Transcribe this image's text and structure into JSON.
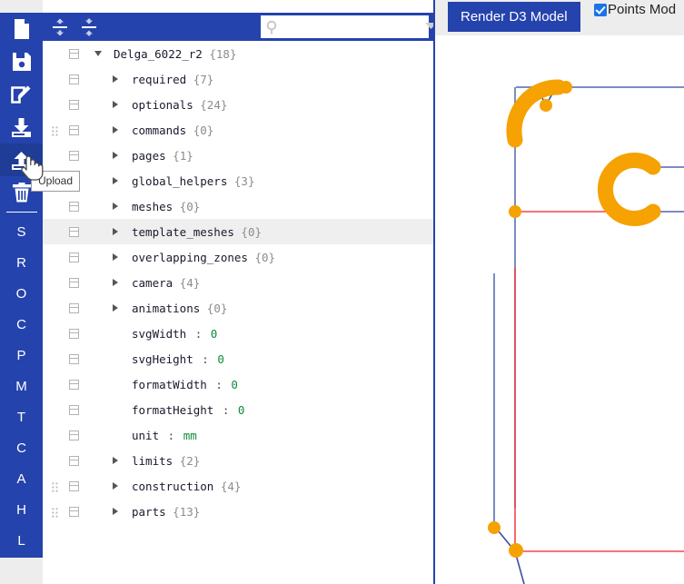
{
  "app": {
    "accent_blue": "#2543ad",
    "selection_blue": "#2a7fff",
    "point_orange": "#f5a202",
    "construction_red": "#f4454d",
    "line_blue": "#7a8cc4"
  },
  "icon_rail": {
    "icons": [
      {
        "name": "new-file-icon",
        "label": "New"
      },
      {
        "name": "save-icon",
        "label": "Save"
      },
      {
        "name": "edit-icon",
        "label": "Edit"
      },
      {
        "name": "download-icon",
        "label": "Download"
      },
      {
        "name": "upload-icon",
        "label": "Upload",
        "active": true
      },
      {
        "name": "trash-icon",
        "label": "Delete"
      }
    ],
    "letters": [
      "S",
      "R",
      "O",
      "C",
      "P",
      "M",
      "T",
      "C",
      "A",
      "H",
      "L"
    ]
  },
  "tooltip": {
    "text": "Upload"
  },
  "tree_toolbar": {
    "expand_all_name": "expand-all-icon",
    "collapse_all_name": "collapse-all-icon",
    "search": {
      "value": "",
      "placeholder": ""
    }
  },
  "tree": {
    "rows": [
      {
        "indent": 0,
        "toggle": "open",
        "label": "Delga_6022_r2",
        "count": "{18}",
        "grip": false,
        "selected": false,
        "kind": "node"
      },
      {
        "indent": 1,
        "toggle": "closed",
        "label": "required",
        "count": "{7}",
        "grip": false,
        "selected": false,
        "kind": "node"
      },
      {
        "indent": 1,
        "toggle": "closed",
        "label": "optionals",
        "count": "{24}",
        "grip": false,
        "selected": false,
        "kind": "node"
      },
      {
        "indent": 1,
        "toggle": "closed",
        "label": "commands",
        "count": "{0}",
        "grip": true,
        "selected": false,
        "kind": "node"
      },
      {
        "indent": 1,
        "toggle": "closed",
        "label": "pages",
        "count": "{1}",
        "grip": false,
        "selected": false,
        "kind": "node"
      },
      {
        "indent": 1,
        "toggle": "closed",
        "label": "global_helpers",
        "count": "{3}",
        "grip": false,
        "selected": false,
        "kind": "node"
      },
      {
        "indent": 1,
        "toggle": "closed",
        "label": "meshes",
        "count": "{0}",
        "grip": false,
        "selected": false,
        "kind": "node"
      },
      {
        "indent": 1,
        "toggle": "closed",
        "label": "template_meshes",
        "count": "{0}",
        "grip": false,
        "selected": true,
        "kind": "node"
      },
      {
        "indent": 1,
        "toggle": "closed",
        "label": "overlapping_zones",
        "count": "{0}",
        "grip": false,
        "selected": false,
        "kind": "node"
      },
      {
        "indent": 1,
        "toggle": "closed",
        "label": "camera",
        "count": "{4}",
        "grip": false,
        "selected": false,
        "kind": "node"
      },
      {
        "indent": 1,
        "toggle": "closed",
        "label": "animations",
        "count": "{0}",
        "grip": false,
        "selected": false,
        "kind": "node"
      },
      {
        "indent": 1,
        "toggle": "none",
        "label": "svgWidth",
        "value": "0",
        "value_type": "num",
        "grip": false,
        "selected": false,
        "kind": "leaf"
      },
      {
        "indent": 1,
        "toggle": "none",
        "label": "svgHeight",
        "value": "0",
        "value_type": "num",
        "grip": false,
        "selected": false,
        "kind": "leaf"
      },
      {
        "indent": 1,
        "toggle": "none",
        "label": "formatWidth",
        "value": "0",
        "value_type": "num",
        "grip": false,
        "selected": false,
        "kind": "leaf"
      },
      {
        "indent": 1,
        "toggle": "none",
        "label": "formatHeight",
        "value": "0",
        "value_type": "num",
        "grip": false,
        "selected": false,
        "kind": "leaf"
      },
      {
        "indent": 1,
        "toggle": "none",
        "label": "unit",
        "value": "mm",
        "value_type": "str",
        "grip": false,
        "selected": false,
        "kind": "leaf"
      },
      {
        "indent": 1,
        "toggle": "closed",
        "label": "limits",
        "count": "{2}",
        "grip": false,
        "selected": false,
        "kind": "node"
      },
      {
        "indent": 1,
        "toggle": "closed",
        "label": "construction",
        "count": "{4}",
        "grip": true,
        "selected": false,
        "kind": "node"
      },
      {
        "indent": 1,
        "toggle": "closed",
        "label": "parts",
        "count": "{13}",
        "grip": true,
        "selected": false,
        "kind": "node"
      }
    ]
  },
  "right_panel": {
    "render_button": "Render D3 Model",
    "points_mode": {
      "label": "Points Mod",
      "checked": true
    }
  }
}
